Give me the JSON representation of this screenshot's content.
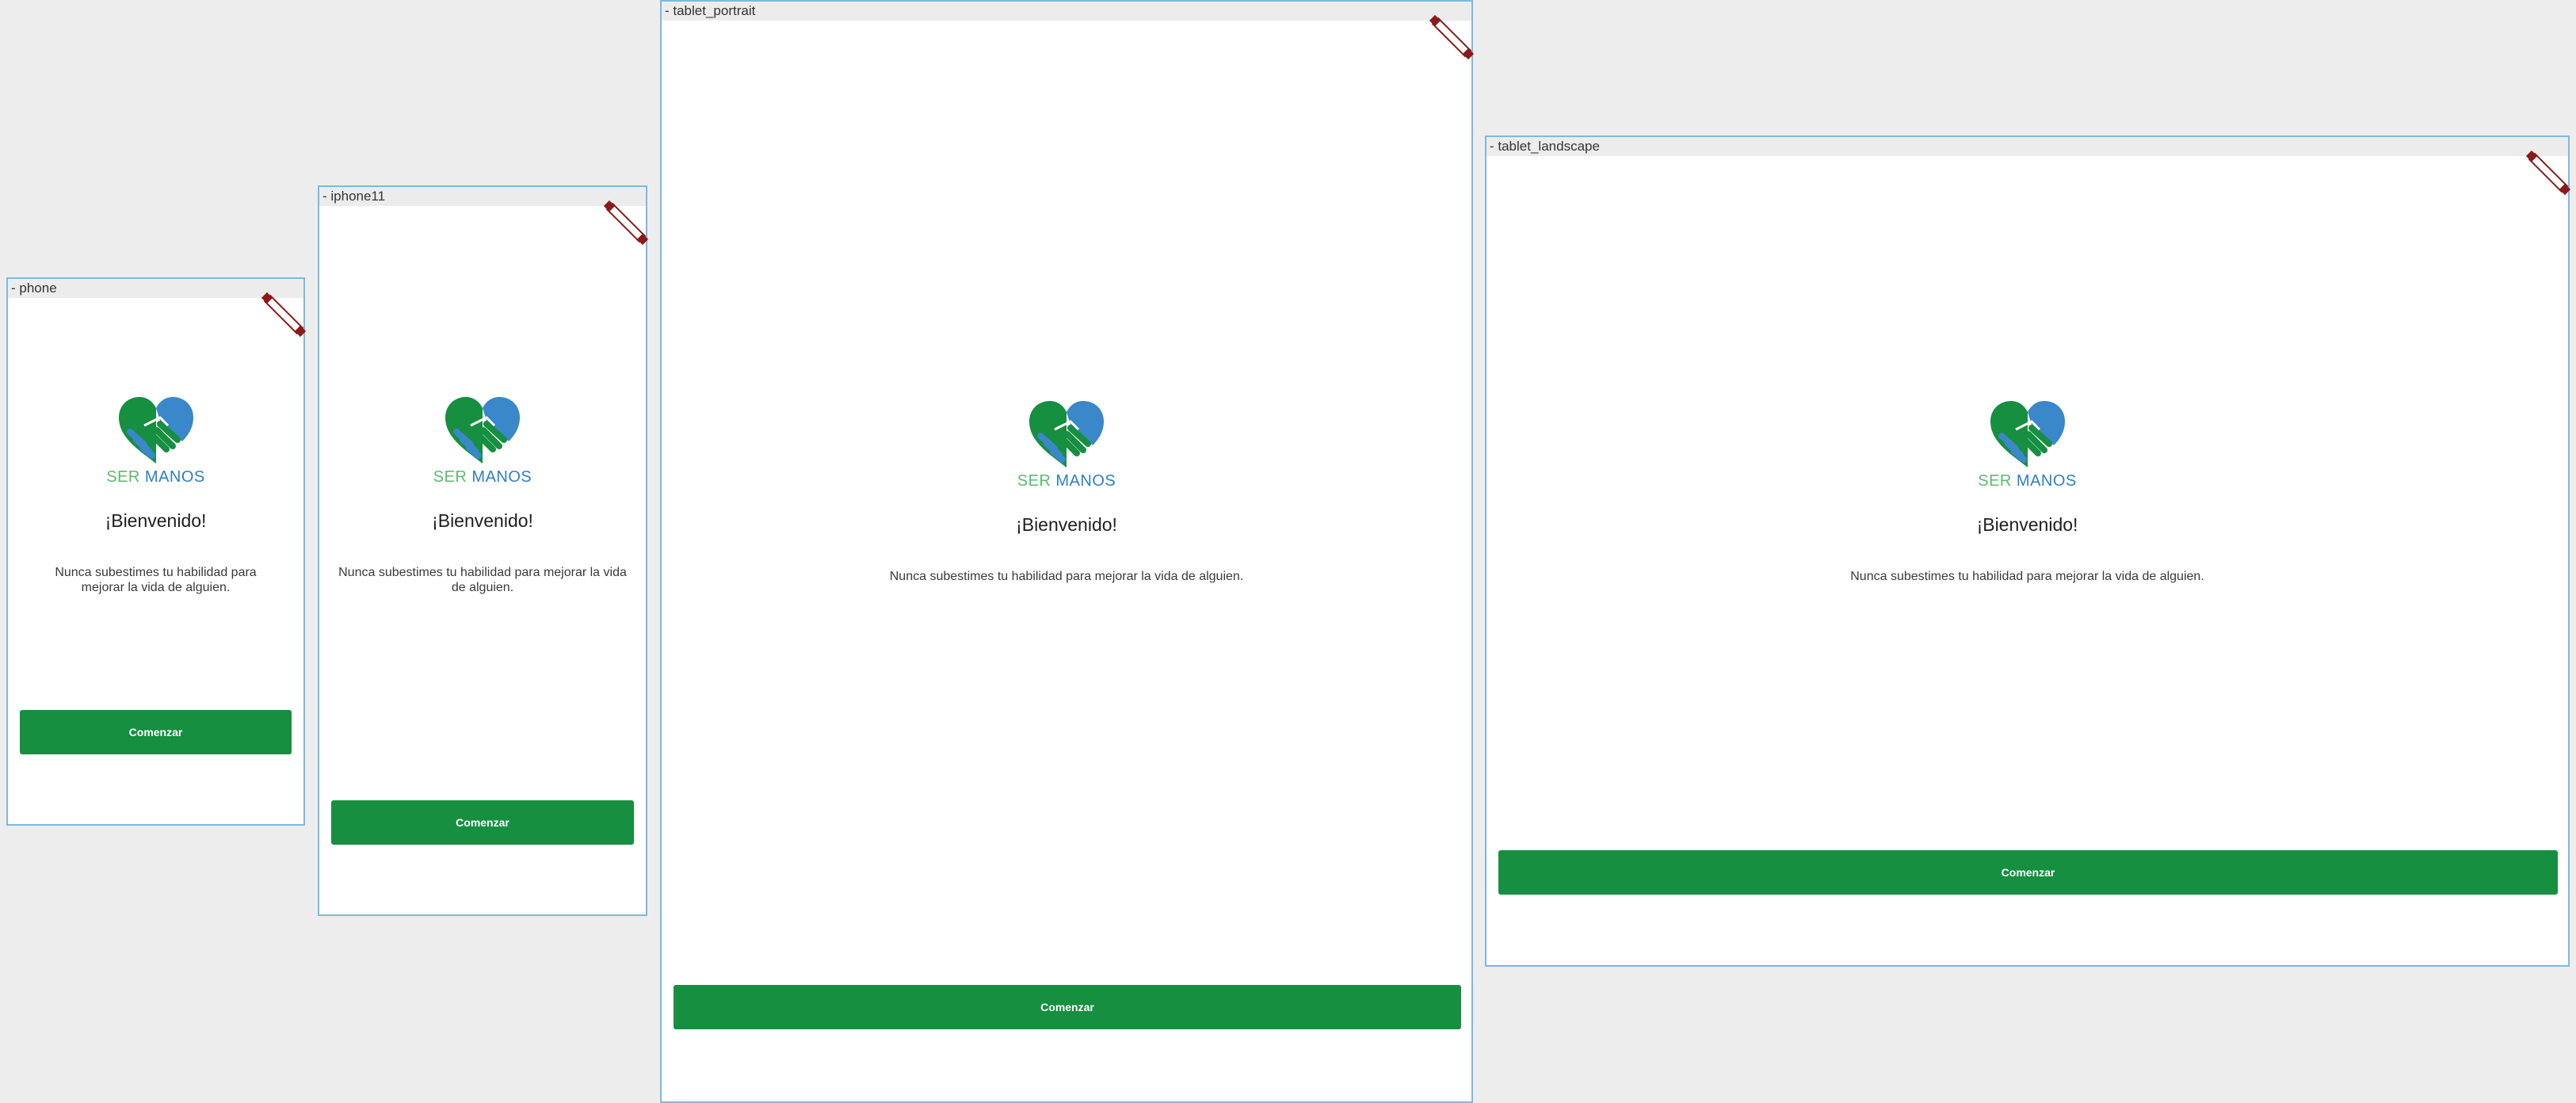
{
  "canvas": {
    "background": "#ededed"
  },
  "colors": {
    "accent_green": "#168f40",
    "brand_green": "#5dba6f",
    "brand_blue": "#2f7fc4",
    "frame_border": "#7cb9e0",
    "handle_red": "#8b1a1a"
  },
  "devices": [
    {
      "label": "- phone",
      "brand": {
        "ser": "SER",
        "manos": "MANOS"
      },
      "title": "¡Bienvenido!",
      "subtitle": "Nunca subestimes tu habilidad para mejorar la vida de alguien.",
      "button_label": "Comenzar"
    },
    {
      "label": "- iphone11",
      "brand": {
        "ser": "SER",
        "manos": "MANOS"
      },
      "title": "¡Bienvenido!",
      "subtitle": "Nunca subestimes tu habilidad para mejorar la vida de alguien.",
      "button_label": "Comenzar"
    },
    {
      "label": "- tablet_portrait",
      "brand": {
        "ser": "SER",
        "manos": "MANOS"
      },
      "title": "¡Bienvenido!",
      "subtitle": "Nunca subestimes tu habilidad para mejorar la vida de alguien.",
      "button_label": "Comenzar"
    },
    {
      "label": "- tablet_landscape",
      "brand": {
        "ser": "SER",
        "manos": "MANOS"
      },
      "title": "¡Bienvenido!",
      "subtitle": "Nunca subestimes tu habilidad para mejorar la vida de alguien.",
      "button_label": "Comenzar"
    }
  ],
  "icons": {
    "logo": "heart-handshake-icon",
    "resize": "resize-handle-icon"
  }
}
